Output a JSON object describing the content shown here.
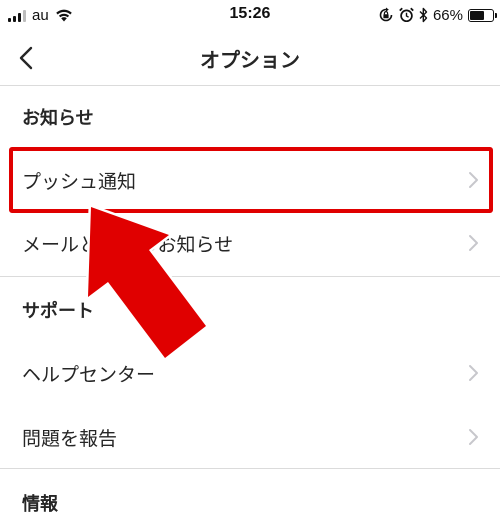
{
  "status_bar": {
    "carrier": "au",
    "time": "15:26",
    "battery_percent": "66%",
    "battery_level": 0.66,
    "signal_bars": 3,
    "icons": [
      "signal-icon",
      "wifi-icon",
      "rotation-lock-icon",
      "alarm-icon",
      "bluetooth-icon",
      "battery-icon"
    ]
  },
  "nav": {
    "title": "オプション",
    "back_icon": "chevron-left-icon"
  },
  "sections": {
    "notifications": {
      "header": "お知らせ",
      "items": [
        {
          "label": "プッシュ通知",
          "icon": "chevron-right-icon"
        },
        {
          "label": "メールとSMSのお知らせ",
          "icon": "chevron-right-icon"
        }
      ]
    },
    "support": {
      "header": "サポート",
      "items": [
        {
          "label": "ヘルプセンター",
          "icon": "chevron-right-icon"
        },
        {
          "label": "問題を報告",
          "icon": "chevron-right-icon"
        }
      ]
    },
    "info": {
      "header": "情報"
    }
  },
  "annotation": {
    "highlight_color": "#e00000",
    "arrow_color": "#e00000"
  },
  "colors": {
    "text": "#262626",
    "divider": "#dbdbdb",
    "chevron": "#c7c7cc",
    "background": "#ffffff"
  }
}
